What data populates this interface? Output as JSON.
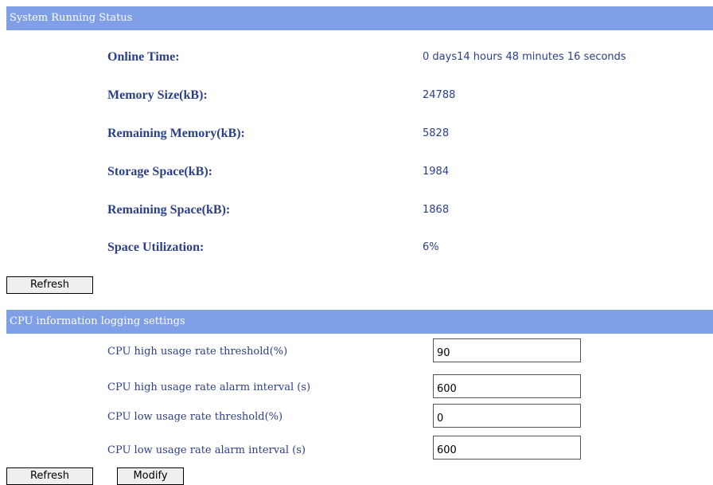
{
  "system_status": {
    "header": "System Running Status",
    "rows": [
      {
        "label": "Online Time:",
        "value": "0 days14 hours 48 minutes 16 seconds"
      },
      {
        "label": "Memory Size(kB):",
        "value": "24788"
      },
      {
        "label": "Remaining Memory(kB):",
        "value": "5828"
      },
      {
        "label": "Storage Space(kB):",
        "value": "1984"
      },
      {
        "label": "Remaining Space(kB):",
        "value": "1868"
      },
      {
        "label": "Space Utilization:",
        "value": "6%"
      }
    ],
    "refresh_label": "Refresh"
  },
  "cpu_logging": {
    "header": "CPU information logging settings",
    "rows": [
      {
        "label": "CPU high usage rate threshold(%)",
        "value": "90"
      },
      {
        "label": "CPU high usage rate alarm interval (s)",
        "value": "600"
      },
      {
        "label": "CPU low usage rate threshold(%)",
        "value": "0"
      },
      {
        "label": "CPU low usage rate alarm interval (s)",
        "value": "600"
      }
    ],
    "refresh_label": "Refresh",
    "modify_label": "Modify"
  },
  "colors": {
    "header_bg": "#7f9fe6",
    "text": "#2b3f8a"
  }
}
